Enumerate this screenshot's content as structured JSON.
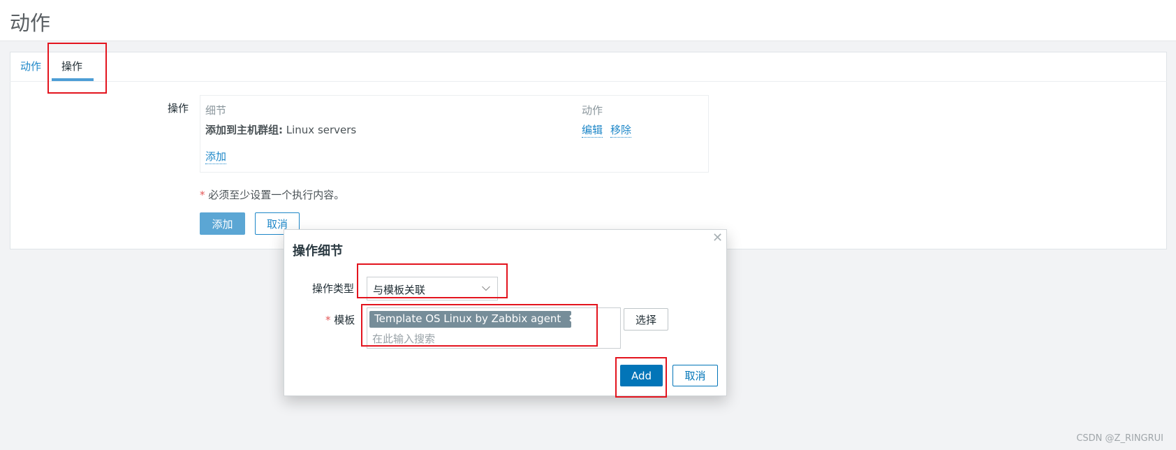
{
  "header": {
    "title": "动作"
  },
  "tabs": [
    {
      "label": "动作",
      "active": false
    },
    {
      "label": "操作",
      "active": true
    }
  ],
  "operations": {
    "label": "操作",
    "columns": {
      "details": "细节",
      "action": "动作"
    },
    "rows": [
      {
        "detail_bold": "添加到主机群组:",
        "detail_value": " Linux servers",
        "edit": "编辑",
        "remove": "移除"
      }
    ],
    "add_link": "添加",
    "required_mark": "*",
    "note": "必须至少设置一个执行内容。"
  },
  "form_buttons": {
    "add": "添加",
    "cancel": "取消"
  },
  "dialog": {
    "title": "操作细节",
    "close_icon": "close-icon",
    "type_label": "操作类型",
    "type_value": "与模板关联",
    "required_mark": "*",
    "template_label": "模板",
    "template_tag": "Template OS Linux by Zabbix agent",
    "search_placeholder": "在此输入搜索",
    "select_button": "选择",
    "add_button": "Add",
    "cancel_button": "取消"
  },
  "colors": {
    "accent": "#1e87c8",
    "primary_button": "#0275b8",
    "highlight": "#e3141e"
  },
  "watermark": "CSDN @Z_RINGRUI"
}
